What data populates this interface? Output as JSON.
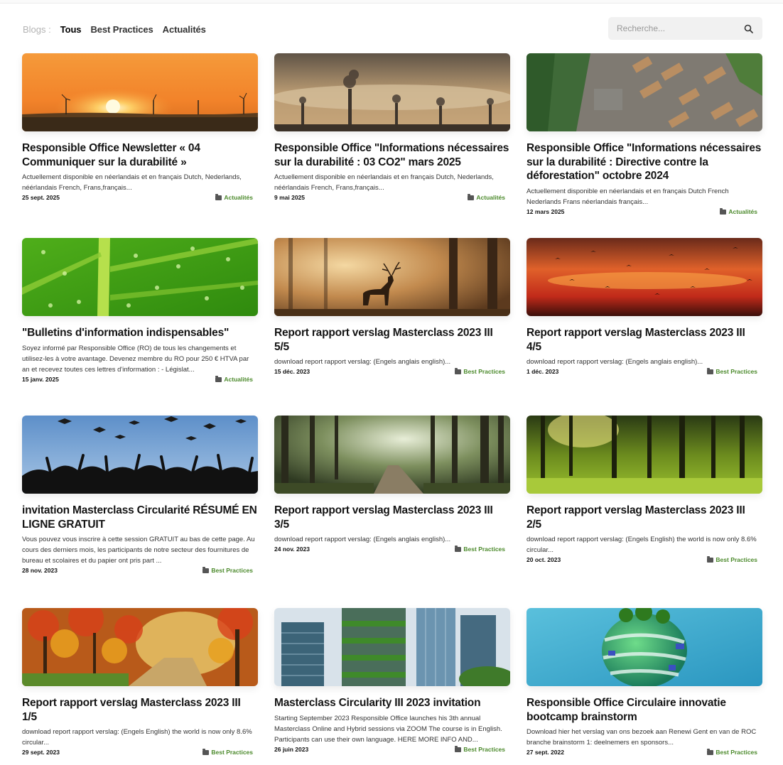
{
  "filters": {
    "label": "Blogs :",
    "items": [
      "Tous",
      "Best Practices",
      "Actualités"
    ]
  },
  "search": {
    "placeholder": "Recherche..."
  },
  "posts": [
    {
      "title": "Responsible Office Newsletter « 04 Communiquer sur la durabilité »",
      "excerpt": "Actuellement disponible en néerlandais et en français Dutch, Nederlands, néérlandais French, Frans,français...",
      "date": "25 sept. 2025",
      "category": "Actualités"
    },
    {
      "title": "Responsible Office \"Informations nécessaires sur la durabilité : 03 CO2\" mars 2025",
      "excerpt": "Actuellement disponible en néerlandais et en français Dutch, Nederlands, néérlandais French, Frans,français...",
      "date": "9 mai 2025",
      "category": "Actualités"
    },
    {
      "title": "Responsible Office \"Informations nécessaires sur la durabilité : Directive contre la déforestation\" octobre 2024",
      "excerpt": "Actuellement disponible en néerlandais et en français  Dutch French Nederlands     Frans néerlandais     français...",
      "date": "12 mars 2025",
      "category": "Actualités"
    },
    {
      "title": "\"Bulletins d'information indispensables\"",
      "excerpt": "Soyez informé par Responsible Office (RO) de tous les changements et utilisez-les à votre avantage. Devenez membre du RO pour 250 € HTVA par an et recevez toutes ces lettres d'information : - Législat...",
      "date": "15 janv. 2025",
      "category": "Actualités"
    },
    {
      "title": "Report rapport verslag Masterclass 2023 III 5/5",
      "excerpt": "download report rapport verslag: (Engels anglais english)...",
      "date": "15 déc. 2023",
      "category": "Best Practices"
    },
    {
      "title": "Report rapport verslag Masterclass 2023 III 4/5",
      "excerpt": "download report rapport verslag: (Engels anglais english)...",
      "date": "1 déc. 2023",
      "category": "Best Practices"
    },
    {
      "title": "invitation Masterclass Circularité RÉSUMÉ EN LIGNE GRATUIT",
      "excerpt": "Vous pouvez vous inscrire à cette session GRATUIT au bas de cette page. Au cours des derniers mois, les participants de notre secteur des fournitures de bureau et scolaires et du papier ont pris part ...",
      "date": "28 nov. 2023",
      "category": "Best Practices"
    },
    {
      "title": "Report rapport verslag Masterclass 2023 III 3/5",
      "excerpt": "download report rapport verslag: (Engels anglais english)...",
      "date": "24 nov. 2023",
      "category": "Best Practices"
    },
    {
      "title": "Report rapport verslag Masterclass 2023 III 2/5",
      "excerpt": "download report rapport verslag: (Engels English) the world is now only 8.6% circular...",
      "date": "20 oct. 2023",
      "category": "Best Practices"
    },
    {
      "title": "Report rapport verslag Masterclass 2023 III 1/5",
      "excerpt": "download report rapport verslag: (Engels English) the world is now only 8.6% circular...",
      "date": "29 sept. 2023",
      "category": "Best Practices"
    },
    {
      "title": "Masterclass Circularity III 2023 invitation",
      "excerpt": "Starting September 2023 Responsible Office launches his 3th annual Masterclass Online and Hybrid sessions via ZOOM The course is in English. Participants can use their own language. HERE MORE INFO AND...",
      "date": "26 juin 2023",
      "category": "Best Practices"
    },
    {
      "title": "Responsible Office Circulaire innovatie bootcamp brainstorm",
      "excerpt": "Download hier het verslag van ons bezoek aan Renewi Gent en van de ROC branche brainstorm 1: deelnemers en sponsors...",
      "date": "27 sept. 2022",
      "category": "Best Practices"
    }
  ],
  "colors": {
    "category": "#4c8a2c",
    "search_bg": "#f1f1f1"
  }
}
